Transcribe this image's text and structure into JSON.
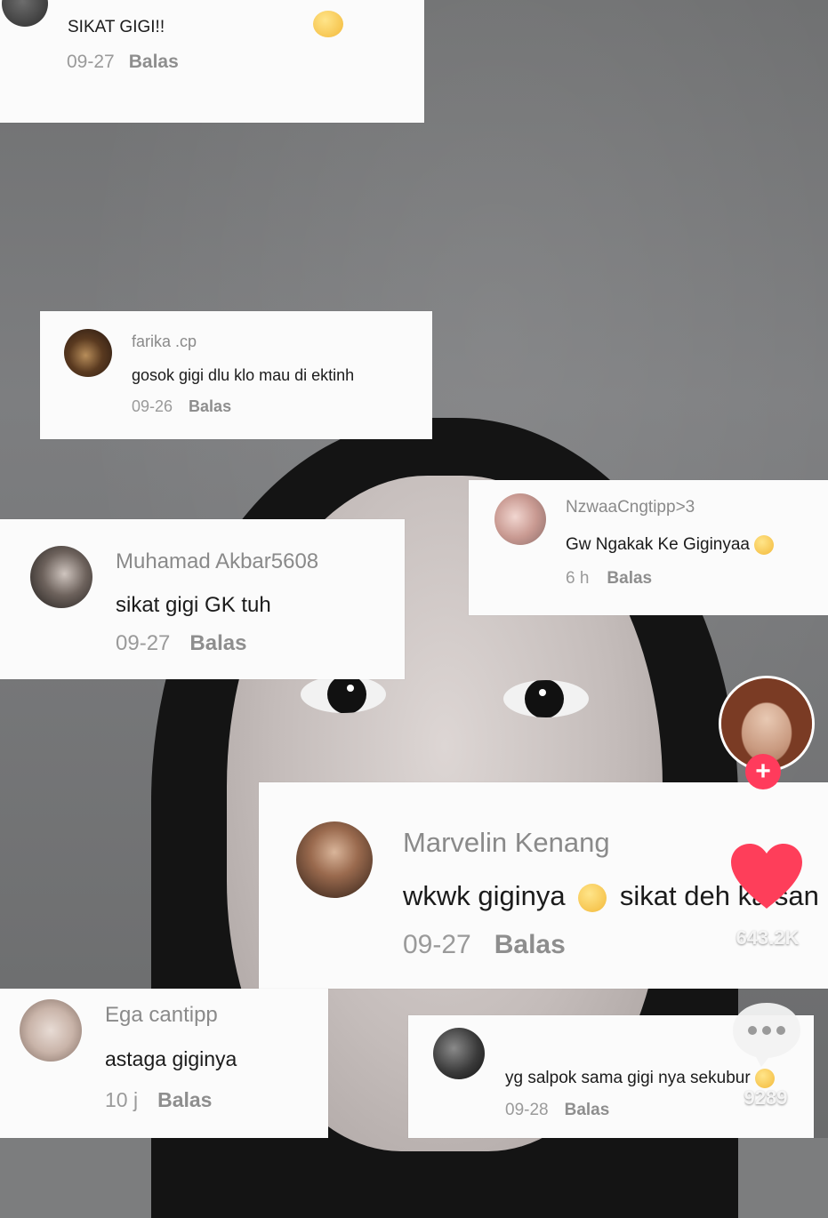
{
  "comments": [
    {
      "username": "",
      "text": "SIKAT GIGI!!",
      "date": "09-27",
      "reply": "Balas"
    },
    {
      "username": "farika .cp",
      "text": "gosok gigi dlu klo mau di ektinh",
      "date": "09-26",
      "reply": "Balas"
    },
    {
      "username": "NzwaaCngtipp>3",
      "text": "Gw Ngakak Ke Giginyaa",
      "date": "6 h",
      "reply": "Balas"
    },
    {
      "username": "Muhamad Akbar5608",
      "text": "sikat gigi GK tuh",
      "date": "09-27",
      "reply": "Balas"
    },
    {
      "username": "Marvelin Kenang",
      "text": "wkwk giginya",
      "text2": "sikat deh ka san",
      "date": "09-27",
      "reply": "Balas"
    },
    {
      "username": "Ega cantipp",
      "text": "astaga giginya",
      "date": "10 j",
      "reply": "Balas"
    },
    {
      "username": "",
      "text": "yg salpok sama gigi nya sekubur",
      "date": "09-28",
      "reply": "Balas"
    }
  ],
  "actions": {
    "follow_label": "+",
    "like_count": "643.2K",
    "comment_count": "9289"
  },
  "colors": {
    "like_heart": "#fe3e5a",
    "follow_button": "#ff3b5c"
  },
  "icons": [
    "heart-icon",
    "comment-bubble-icon",
    "plus-icon",
    "emoji-icon"
  ]
}
